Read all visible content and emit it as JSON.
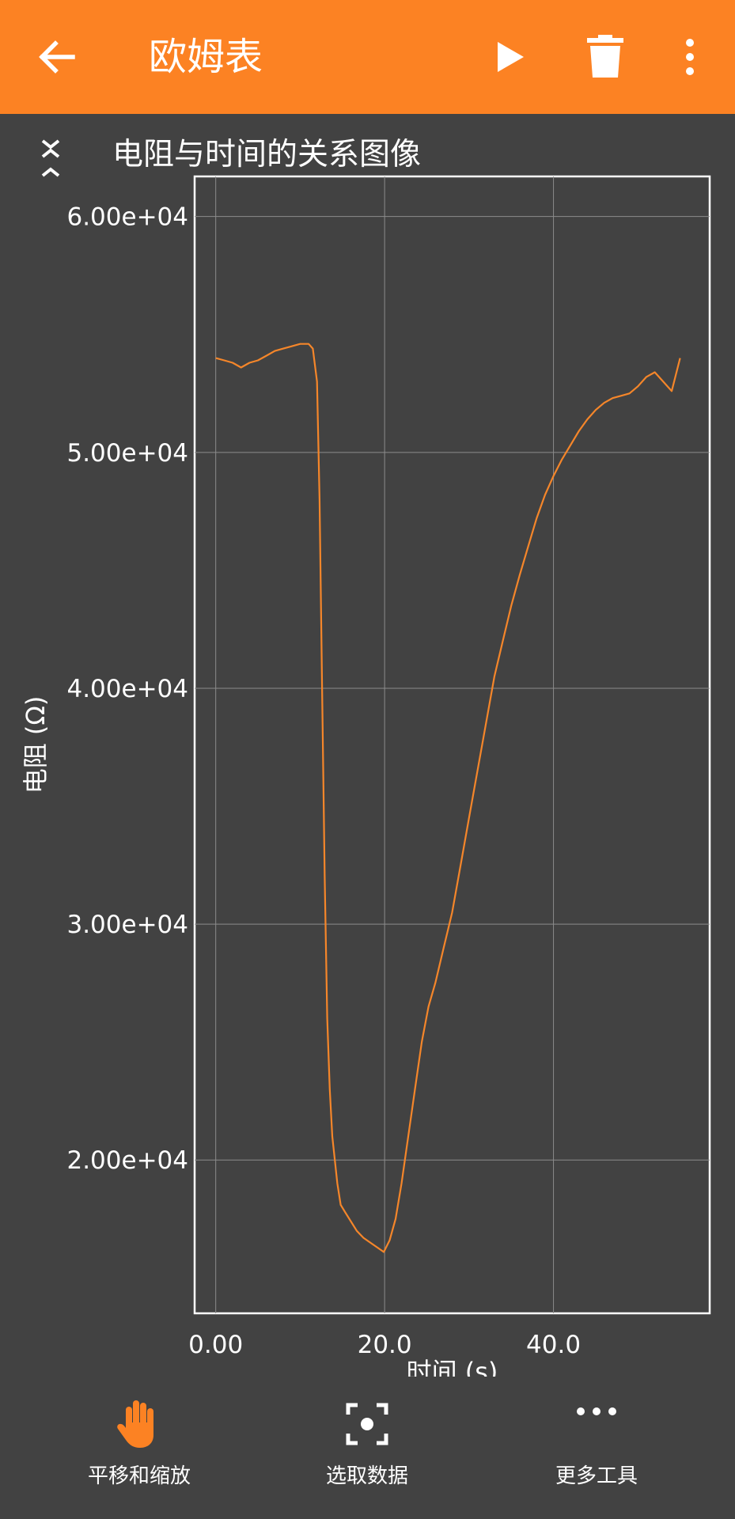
{
  "app_bar": {
    "title": "欧姆表",
    "back_icon": "arrow-left-icon",
    "play_icon": "play-icon",
    "delete_icon": "trash-icon",
    "more_icon": "more-vertical-icon",
    "background": "#fc8223"
  },
  "graph": {
    "collapse_icon": "collapse-chevrons-icon",
    "title": "电阻与时间的关系图像"
  },
  "chart_data": {
    "type": "line",
    "title": "电阻与时间的关系图像",
    "xlabel": "时间 (s)",
    "ylabel": "电阻 (Ω)",
    "xlim": [
      -2.5,
      58.5
    ],
    "ylim": [
      13500,
      61700
    ],
    "x_ticks": [
      0,
      20,
      40
    ],
    "x_tick_labels": [
      "0.00",
      "20.0",
      "40.0"
    ],
    "y_ticks": [
      20000,
      30000,
      40000,
      50000,
      60000
    ],
    "y_tick_labels": [
      "2.00e+04",
      "3.00e+04",
      "4.00e+04",
      "5.00e+04",
      "6.00e+04"
    ],
    "grid": true,
    "line_color": "#f5862a",
    "series": [
      {
        "x": [
          0,
          1,
          2,
          3,
          4,
          5,
          6,
          7,
          8,
          9,
          10,
          11,
          11.5,
          12,
          12.3,
          12.6,
          12.9,
          13.2,
          13.5,
          13.8,
          14.1,
          14.4,
          14.8,
          15.3,
          16,
          16.7,
          17.5,
          18.3,
          19.1,
          19.9,
          20.6,
          21.3,
          22,
          22.8,
          23.6,
          24.4,
          25.2,
          26,
          27,
          28,
          29,
          30,
          31,
          32,
          33,
          34,
          35,
          36,
          37,
          38,
          39,
          40,
          41,
          42,
          43,
          44,
          45,
          46,
          47,
          48,
          49,
          50,
          51,
          52,
          53,
          54,
          55
        ],
        "y": [
          54000,
          53900,
          53800,
          53600,
          53800,
          53900,
          54100,
          54300,
          54400,
          54500,
          54600,
          54600,
          54400,
          53000,
          48000,
          40000,
          32000,
          26000,
          23000,
          21000,
          20000,
          19000,
          18100,
          17800,
          17400,
          17000,
          16700,
          16500,
          16300,
          16100,
          16600,
          17500,
          19000,
          21000,
          23000,
          25000,
          26500,
          27500,
          29000,
          30500,
          32500,
          34500,
          36500,
          38500,
          40500,
          42000,
          43500,
          44800,
          46000,
          47200,
          48200,
          49000,
          49700,
          50300,
          50900,
          51400,
          51800,
          52100,
          52300,
          52400,
          52500,
          52800,
          53200,
          53400,
          53000,
          52600,
          54000
        ]
      }
    ]
  },
  "bottom_toolbar": {
    "items": [
      {
        "label": "平移和缩放",
        "icon": "hand-icon"
      },
      {
        "label": "选取数据",
        "icon": "select-point-icon"
      },
      {
        "label": "更多工具",
        "icon": "more-horizontal-icon"
      }
    ]
  }
}
